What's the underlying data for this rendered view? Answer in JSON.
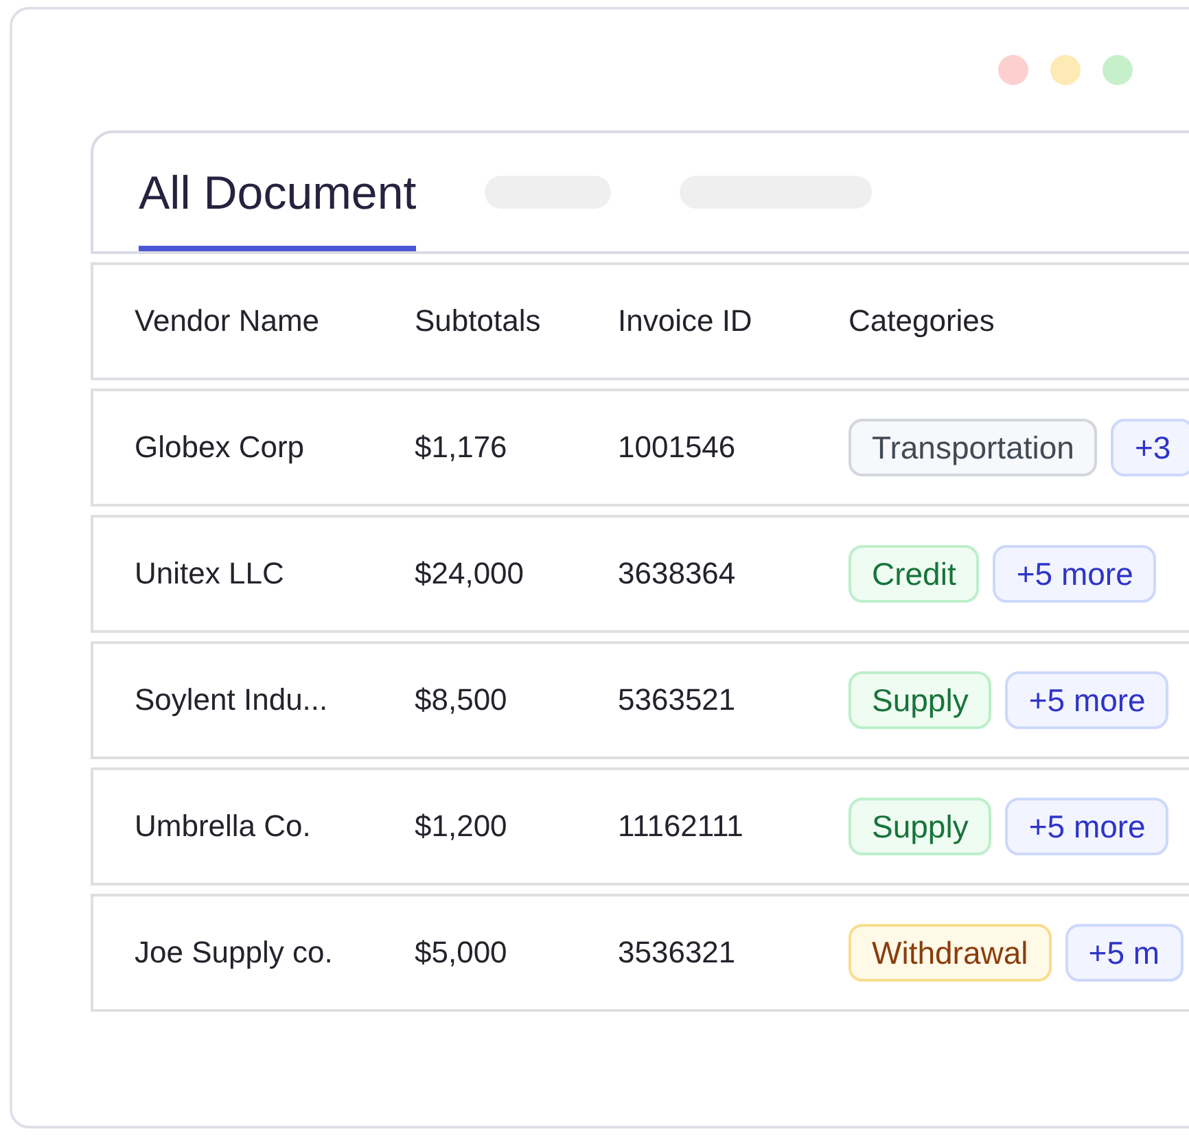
{
  "window": {
    "controls": [
      {
        "color": "#fdd0d0"
      },
      {
        "color": "#feeab5"
      },
      {
        "color": "#c6f0c9"
      }
    ]
  },
  "tabs": [
    {
      "label": "All Document",
      "selected": true
    },
    {
      "kind": "placeholder",
      "selected": false
    },
    {
      "kind": "placeholder",
      "selected": false
    }
  ],
  "table": {
    "columns": [
      "Vendor Name",
      "Subtotals",
      "Invoice ID",
      "Categories"
    ],
    "rows": [
      {
        "vendor": "Globex Corp",
        "subtotal": "$1,176",
        "invoice_id": "1001546",
        "categories": [
          {
            "label": "Transportation",
            "kind": "neutral"
          },
          {
            "label": "+3",
            "kind": "more"
          }
        ]
      },
      {
        "vendor": "Unitex LLC",
        "subtotal": "$24,000",
        "invoice_id": "3638364",
        "categories": [
          {
            "label": "Credit",
            "kind": "success"
          },
          {
            "label": "+5 more",
            "kind": "more"
          }
        ]
      },
      {
        "vendor": "Soylent Indu...",
        "subtotal": "$8,500",
        "invoice_id": "5363521",
        "categories": [
          {
            "label": "Supply",
            "kind": "success"
          },
          {
            "label": "+5 more",
            "kind": "more"
          }
        ]
      },
      {
        "vendor": "Umbrella Co.",
        "subtotal": "$1,200",
        "invoice_id": "11162111",
        "categories": [
          {
            "label": "Supply",
            "kind": "success"
          },
          {
            "label": "+5 more",
            "kind": "more"
          }
        ]
      },
      {
        "vendor": "Joe Supply co.",
        "subtotal": "$5,000",
        "invoice_id": "3536321",
        "categories": [
          {
            "label": "Withdrawal",
            "kind": "warning"
          },
          {
            "label": "+5 m",
            "kind": "more"
          }
        ]
      }
    ]
  }
}
